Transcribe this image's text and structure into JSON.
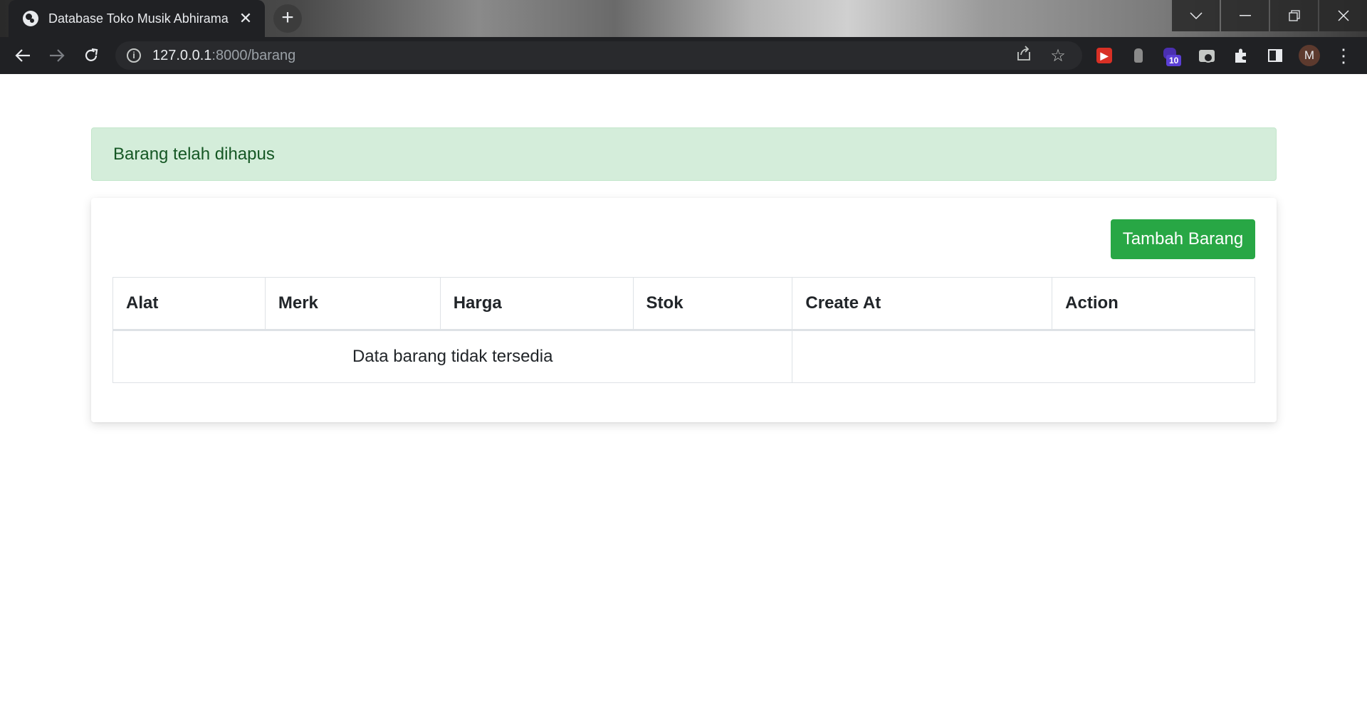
{
  "browser": {
    "tab_title": "Database Toko Musik Abhirama",
    "tab_close": "✕",
    "new_tab": "+",
    "url_host": "127.0.0.1",
    "url_path": ":8000/barang",
    "extensions_badge": "10",
    "profile_initial": "M",
    "icons": {
      "window_dropdown": "chevron-down-icon",
      "minimize": "minimize-icon",
      "restore": "restore-icon",
      "close": "close-icon"
    }
  },
  "alert": {
    "message": "Barang telah dihapus",
    "bg_color": "#d4edda",
    "text_color": "#155724"
  },
  "toolbar": {
    "add_button_label": "Tambah Barang",
    "add_button_color": "#28a745"
  },
  "table": {
    "columns": [
      "Alat",
      "Merk",
      "Harga",
      "Stok",
      "Create At",
      "Action"
    ],
    "empty_message": "Data barang tidak tersedia"
  }
}
